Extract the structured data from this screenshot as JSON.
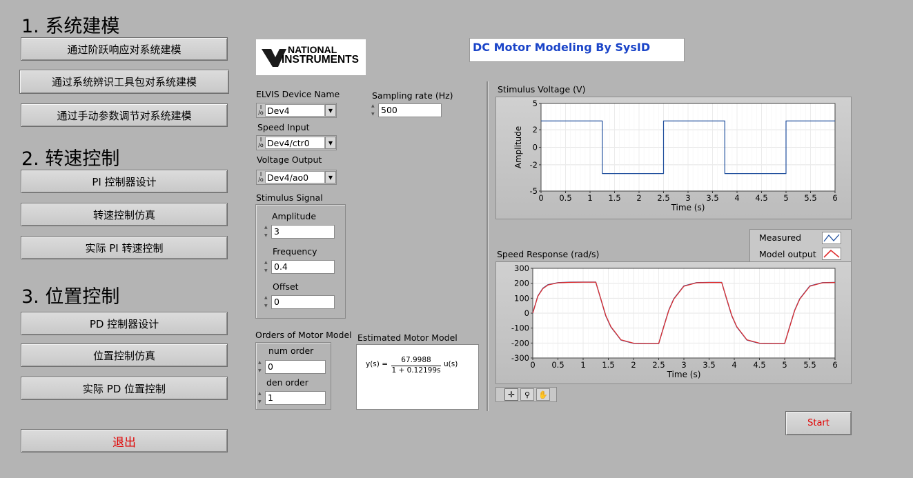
{
  "sections": {
    "modeling_title": "1. 系统建模",
    "speed_title": "2. 转速控制",
    "position_title": "3. 位置控制"
  },
  "buttons": {
    "step_response": "通过阶跃响应对系统建模",
    "sysid_toolkit": "通过系统辨识工具包对系统建模",
    "manual_tuning": "通过手动参数调节对系统建模",
    "pi_design": "PI 控制器设计",
    "speed_sim": "转速控制仿真",
    "real_pi": "实际 PI 转速控制",
    "pd_design": "PD 控制器设计",
    "position_sim": "位置控制仿真",
    "real_pd": "实际 PD 位置控制",
    "exit": "退出",
    "start": "Start"
  },
  "logo": {
    "line1": "NATIONAL",
    "line2": "INSTRUMENTS"
  },
  "vi_title": "DC Motor Modeling By SysID",
  "elvis": {
    "label": "ELVIS Device Name",
    "value": "Dev4"
  },
  "speed_input": {
    "label": "Speed Input",
    "value": "Dev4/ctr0"
  },
  "voltage_output": {
    "label": "Voltage Output",
    "value": "Dev4/ao0"
  },
  "sampling": {
    "label": "Sampling rate (Hz)",
    "value": "500"
  },
  "stimulus": {
    "label": "Stimulus Signal",
    "amplitude_label": "Amplitude",
    "amplitude": "3",
    "frequency_label": "Frequency",
    "frequency": "0.4",
    "offset_label": "Offset",
    "offset": "0"
  },
  "orders": {
    "label": "Orders of Motor Model",
    "num_label": "num order",
    "num": "0",
    "den_label": "den order",
    "den": "1"
  },
  "model": {
    "label": "Estimated Motor Model",
    "lhs": "y(s) =",
    "numerator": "67.9988",
    "denominator": "1 + 0.12199s",
    "rhs": "u(s)"
  },
  "colors": {
    "measured": "#1f4e9c",
    "model": "#e03030",
    "stimulus": "#1f4e9c",
    "exit_text": "#e00000",
    "title": "#1a44c8"
  },
  "palette_icons": [
    "crosshair-icon",
    "zoom-icon",
    "hand-icon"
  ],
  "chart_data": [
    {
      "type": "line",
      "title": "Stimulus Voltage (V)",
      "xlabel": "Time (s)",
      "ylabel": "Amplitude",
      "xlim": [
        0,
        6
      ],
      "ylim": [
        -5,
        5
      ],
      "xticks": [
        "0",
        "0.5",
        "1",
        "1.5",
        "2",
        "2.5",
        "3",
        "3.5",
        "4",
        "4.5",
        "5",
        "5.5",
        "6"
      ],
      "yticks": [
        "5",
        "2",
        "0",
        "-2",
        "-5"
      ],
      "grid": true,
      "series": [
        {
          "x": [
            0,
            1.25,
            1.25,
            2.5,
            2.5,
            3.75,
            3.75,
            5.0,
            5.0,
            6.0
          ],
          "y": [
            3,
            3,
            -3,
            -3,
            3,
            3,
            -3,
            -3,
            3,
            3
          ]
        }
      ]
    },
    {
      "type": "line",
      "title": "Speed Response (rad/s)",
      "xlabel": "Time (s)",
      "xlim": [
        0,
        6
      ],
      "ylim": [
        -300,
        300
      ],
      "xticks": [
        "0",
        "0.5",
        "1",
        "1.5",
        "2",
        "2.5",
        "3",
        "3.5",
        "4",
        "4.5",
        "5",
        "5.5",
        "6"
      ],
      "yticks": [
        "300",
        "200",
        "100",
        "0",
        "-100",
        "-200",
        "-300"
      ],
      "grid": true,
      "legend": "top-right",
      "series": [
        {
          "name": "Measured",
          "x": [
            0,
            0.1,
            0.2,
            0.3,
            0.5,
            0.75,
            1.0,
            1.25,
            1.35,
            1.45,
            1.55,
            1.75,
            2.0,
            2.25,
            2.5,
            2.6,
            2.7,
            2.8,
            3.0,
            3.25,
            3.5,
            3.75,
            3.85,
            3.95,
            4.05,
            4.25,
            4.5,
            4.75,
            5.0,
            5.1,
            5.2,
            5.3,
            5.5,
            5.75,
            6.0
          ],
          "y": [
            0,
            114,
            166,
            190,
            204,
            207,
            208,
            208,
            94,
            -18,
            -92,
            -180,
            -202,
            -204,
            -204,
            -90,
            20,
            96,
            182,
            204,
            206,
            206,
            92,
            -18,
            -92,
            -180,
            -202,
            -204,
            -204,
            -90,
            20,
            96,
            182,
            204,
            206
          ]
        },
        {
          "name": "Model output",
          "x": [
            0,
            0.1,
            0.2,
            0.3,
            0.5,
            0.75,
            1.0,
            1.25,
            1.35,
            1.45,
            1.55,
            1.75,
            2.0,
            2.25,
            2.5,
            2.6,
            2.7,
            2.8,
            3.0,
            3.25,
            3.5,
            3.75,
            3.85,
            3.95,
            4.05,
            4.25,
            4.5,
            4.75,
            5.0,
            5.1,
            5.2,
            5.3,
            5.5,
            5.75,
            6.0
          ],
          "y": [
            0,
            112,
            164,
            188,
            203,
            206,
            207,
            207,
            96,
            -15,
            -90,
            -178,
            -201,
            -203,
            -203,
            -92,
            18,
            94,
            180,
            203,
            205,
            205,
            94,
            -15,
            -90,
            -178,
            -201,
            -203,
            -203,
            -92,
            18,
            94,
            180,
            203,
            205
          ]
        }
      ]
    }
  ]
}
